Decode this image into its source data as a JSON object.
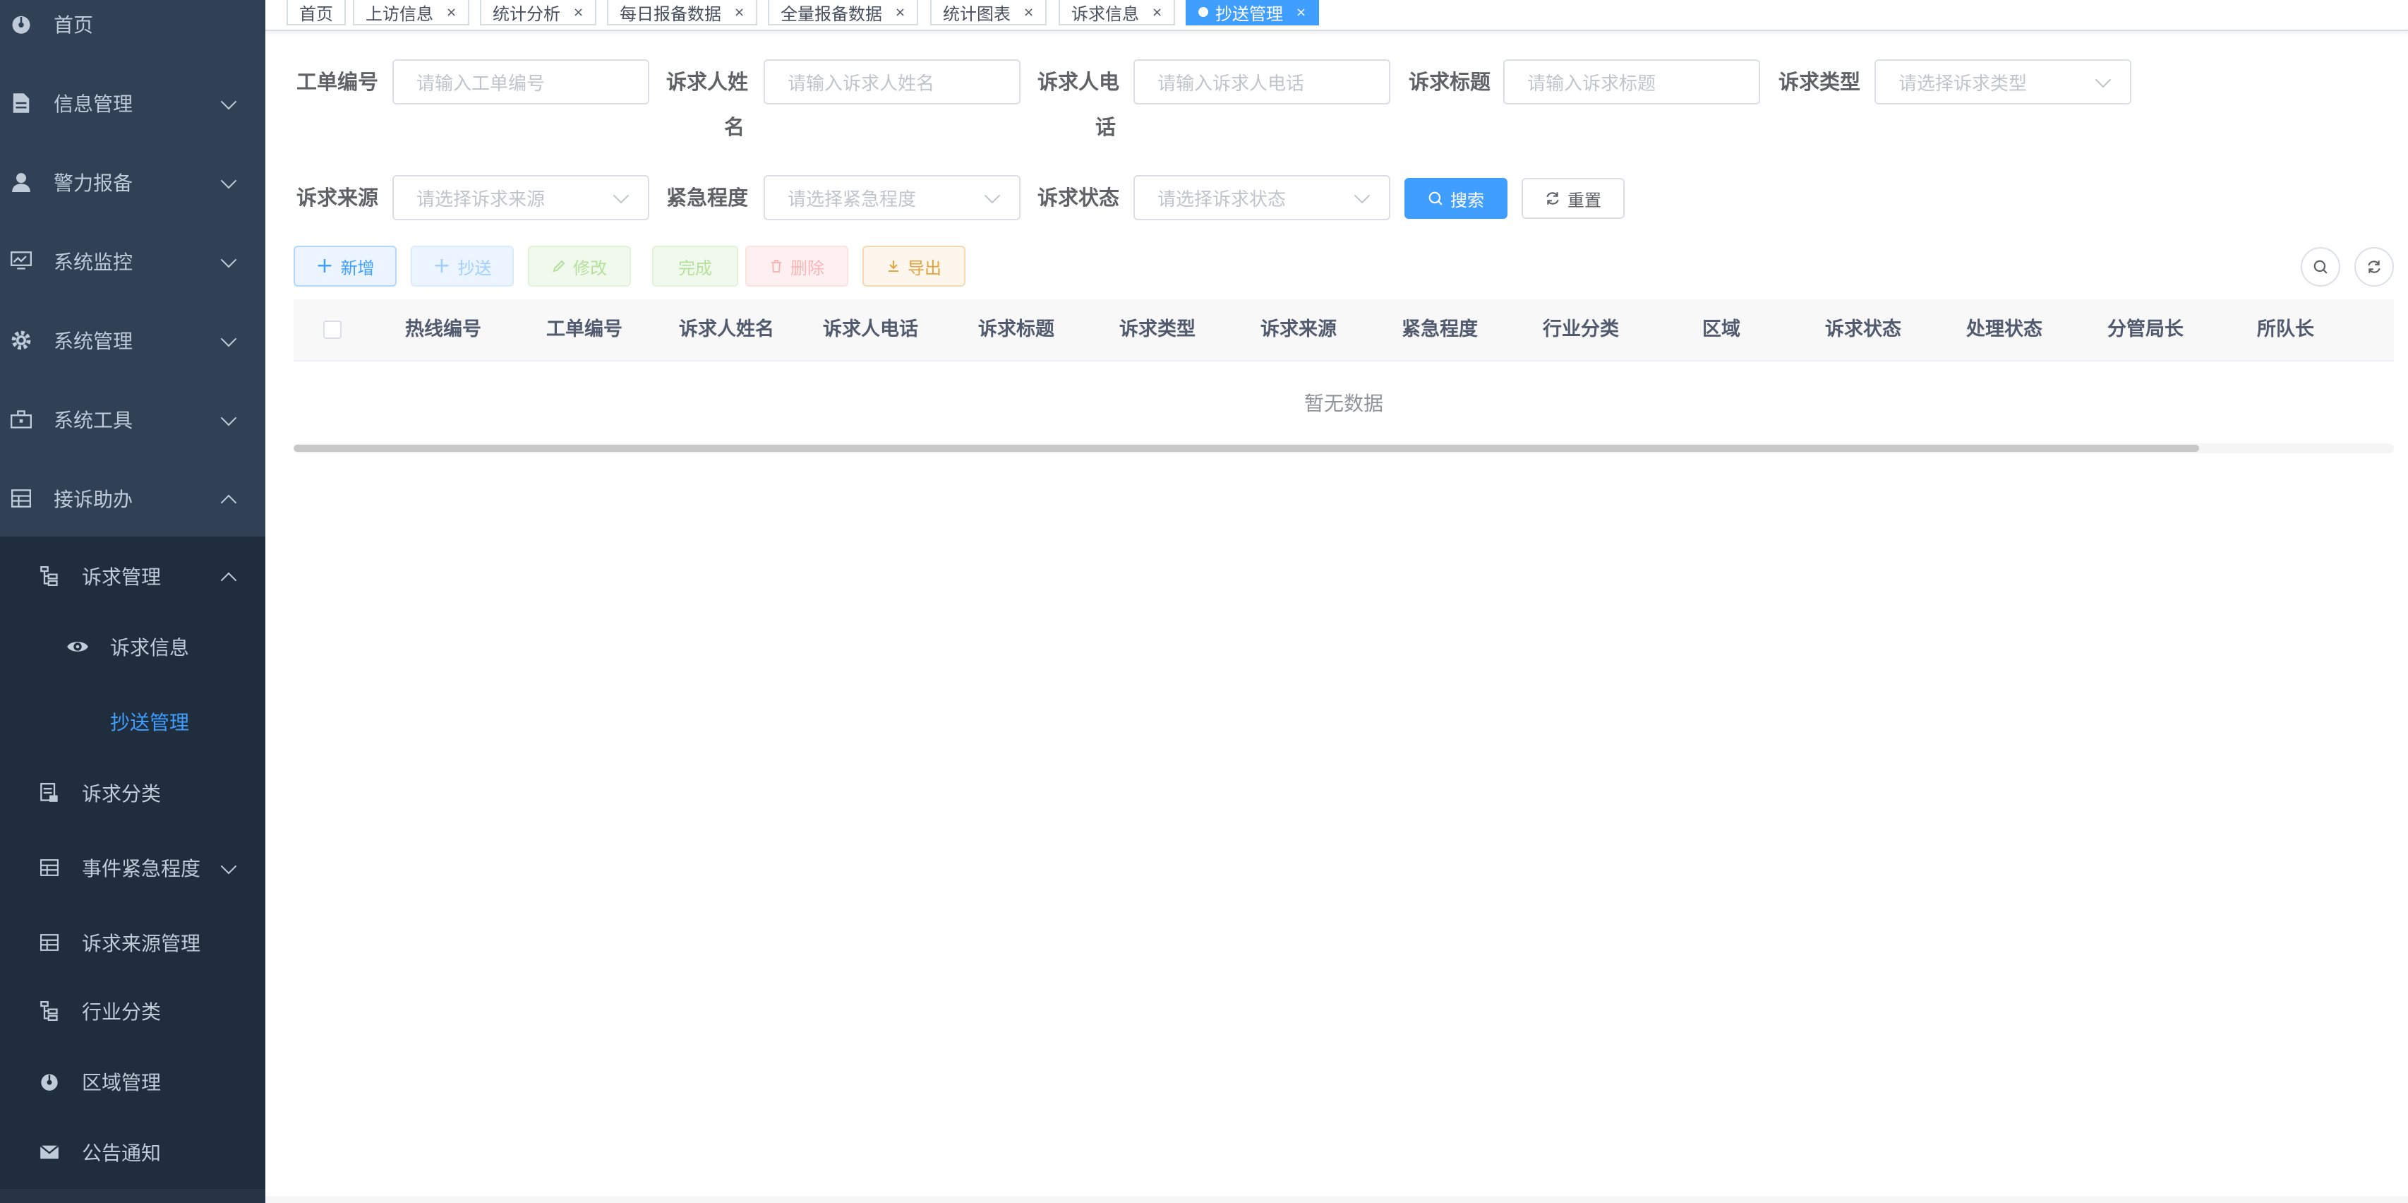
{
  "sidebar": {
    "items": [
      {
        "label": "首页",
        "icon": "dashboard-icon"
      },
      {
        "label": "信息管理",
        "icon": "document-icon"
      },
      {
        "label": "警力报备",
        "icon": "user-icon"
      },
      {
        "label": "系统监控",
        "icon": "monitor-icon"
      },
      {
        "label": "系统管理",
        "icon": "gear-icon"
      },
      {
        "label": "系统工具",
        "icon": "toolbox-icon"
      },
      {
        "label": "接诉助办",
        "icon": "table-icon"
      }
    ],
    "sub_items": [
      {
        "label": "诉求管理",
        "icon": "tree-icon"
      },
      {
        "label": "诉求信息",
        "icon": "eye-icon"
      },
      {
        "label": "抄送管理",
        "icon": ""
      },
      {
        "label": "诉求分类",
        "icon": "code-icon"
      },
      {
        "label": "事件紧急程度",
        "icon": "table-icon"
      },
      {
        "label": "诉求来源管理",
        "icon": "table-icon"
      },
      {
        "label": "行业分类",
        "icon": "tree-icon"
      },
      {
        "label": "区域管理",
        "icon": "dashboard-icon"
      },
      {
        "label": "公告通知",
        "icon": "message-icon"
      }
    ]
  },
  "tags": [
    {
      "label": "首页"
    },
    {
      "label": "上访信息"
    },
    {
      "label": "统计分析"
    },
    {
      "label": "每日报备数据"
    },
    {
      "label": "全量报备数据"
    },
    {
      "label": "统计图表"
    },
    {
      "label": "诉求信息"
    },
    {
      "label": "抄送管理"
    }
  ],
  "close_glyph": "×",
  "form": {
    "order_no": {
      "label": "工单编号",
      "placeholder": "请输入工单编号"
    },
    "name": {
      "label_line1": "诉求人姓",
      "label_line2": "名",
      "placeholder": "请输入诉求人姓名"
    },
    "phone": {
      "label_line1": "诉求人电",
      "label_line2": "话",
      "placeholder": "请输入诉求人电话"
    },
    "title": {
      "label": "诉求标题",
      "placeholder": "请输入诉求标题"
    },
    "type": {
      "label": "诉求类型",
      "placeholder": "请选择诉求类型"
    },
    "source": {
      "label": "诉求来源",
      "placeholder": "请选择诉求来源"
    },
    "urgency": {
      "label": "紧急程度",
      "placeholder": "请选择紧急程度"
    },
    "status": {
      "label": "诉求状态",
      "placeholder": "请选择诉求状态"
    },
    "search_button": "搜索",
    "reset_button": "重置"
  },
  "toolbar": {
    "add": "新增",
    "cc": "抄送",
    "edit": "修改",
    "complete": "完成",
    "delete": "删除",
    "export": "导出"
  },
  "table": {
    "columns": [
      "热线编号",
      "工单编号",
      "诉求人姓名",
      "诉求人电话",
      "诉求标题",
      "诉求类型",
      "诉求来源",
      "紧急程度",
      "行业分类",
      "区域",
      "诉求状态",
      "处理状态",
      "分管局长",
      "所队长"
    ],
    "empty_text": "暂无数据"
  },
  "colors": {
    "sidebar_bg": "#304156",
    "submenu_bg": "#1f2d3d",
    "primary": "#409eff",
    "success": "#67c23a",
    "danger": "#f56c6c",
    "warning": "#e6a23c"
  }
}
